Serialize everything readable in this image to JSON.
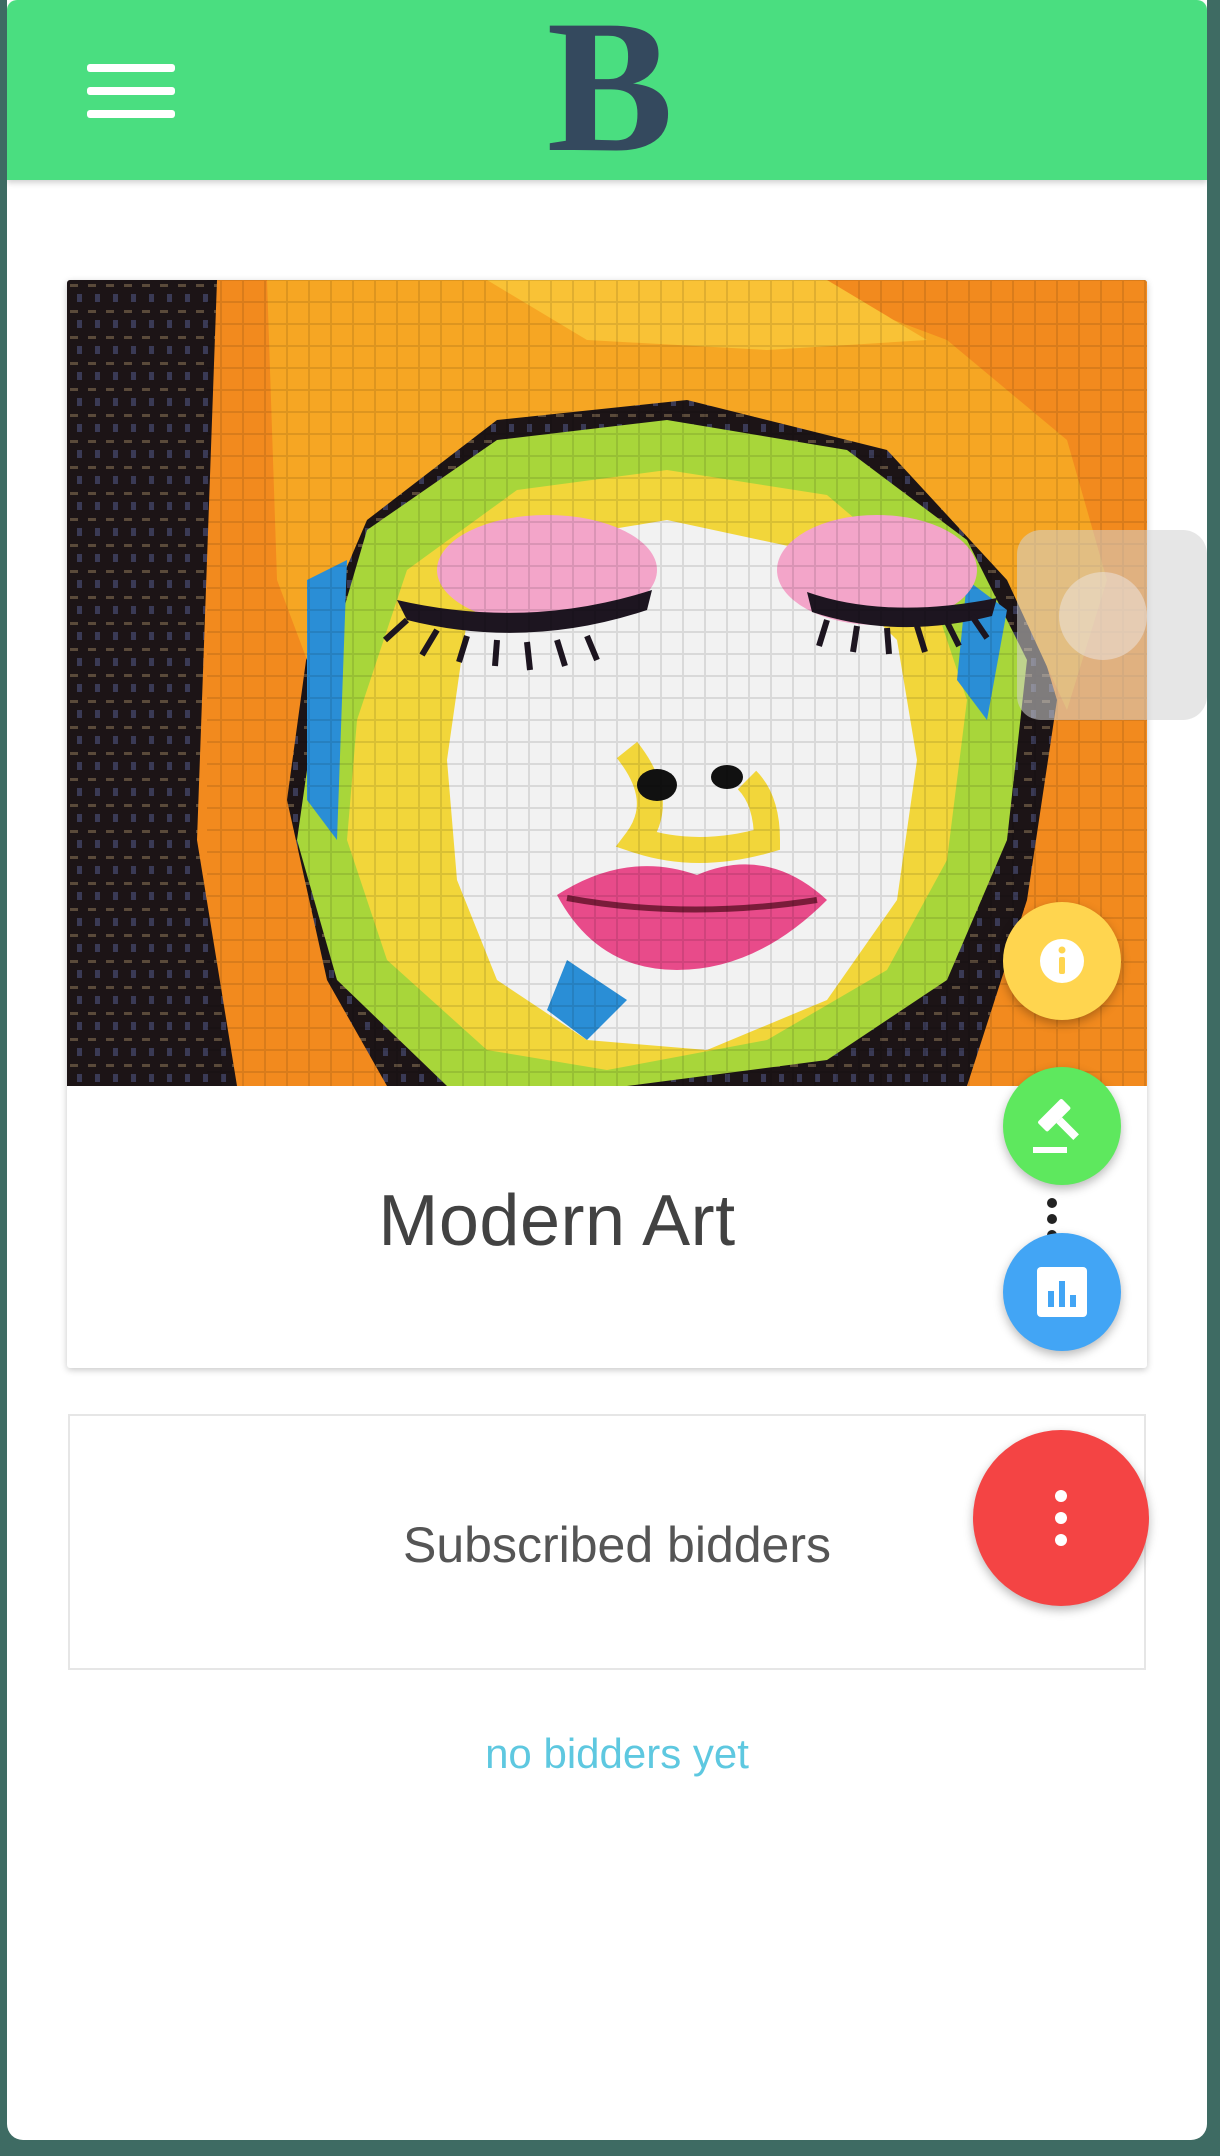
{
  "app": {
    "logo_text": "B"
  },
  "item": {
    "title": "Modern Art"
  },
  "bidders": {
    "heading": "Subscribed bidders",
    "empty_text": "no bidders yet"
  },
  "icons": {
    "menu": "hamburger-menu-icon",
    "info": "info-icon",
    "bid": "gavel-icon",
    "stats": "bar-chart-icon",
    "more": "more-vertical-icon"
  },
  "colors": {
    "appbar": "#4ade80",
    "logo": "#34495e",
    "fab_info": "#ffd54f",
    "fab_bid": "#5ee85e",
    "fab_stats": "#42a5f5",
    "fab_main": "#f44444",
    "empty_text": "#5ec8e0"
  }
}
